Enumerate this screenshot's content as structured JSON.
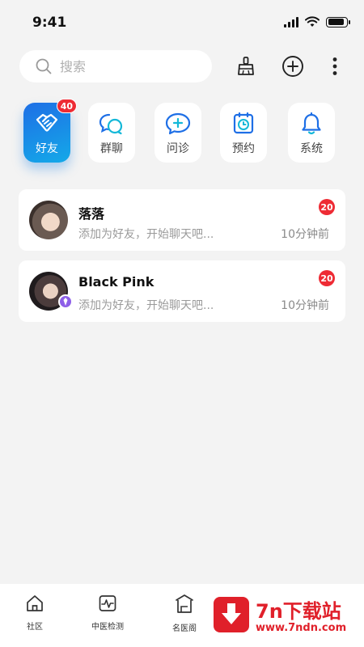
{
  "status_bar": {
    "time": "9:41",
    "battery_level": 0.9
  },
  "header": {
    "search_placeholder": "搜索",
    "icons": [
      "broom-icon",
      "plus-circle-icon",
      "more-vertical-icon"
    ]
  },
  "categories": [
    {
      "label": "好友",
      "icon": "handshake-icon",
      "badge": "40",
      "active": true
    },
    {
      "label": "群聊",
      "icon": "chat-bubbles-icon"
    },
    {
      "label": "问诊",
      "icon": "chat-plus-icon"
    },
    {
      "label": "预约",
      "icon": "clock-icon"
    },
    {
      "label": "系统",
      "icon": "bell-icon"
    }
  ],
  "conversations": [
    {
      "name": "落落",
      "message": "添加为好友，开始聊天吧...",
      "time": "10分钟前",
      "badge": "20"
    },
    {
      "name": "Black Pink",
      "message": "添加为好友，开始聊天吧...",
      "time": "10分钟前",
      "badge": "20",
      "vip": true
    }
  ],
  "tabbar": {
    "items": [
      {
        "label": "社区",
        "icon": "house-icon"
      },
      {
        "label": "中医检测",
        "icon": "pulse-icon"
      },
      {
        "label": "名医阁",
        "icon": "pavilion-icon"
      }
    ]
  },
  "watermark": {
    "title": "7n下载站",
    "url": "www.7ndn.com"
  },
  "colors": {
    "accent": "#1e6fe6",
    "badge": "#ee2b34",
    "vip": "#8e5fe8"
  }
}
